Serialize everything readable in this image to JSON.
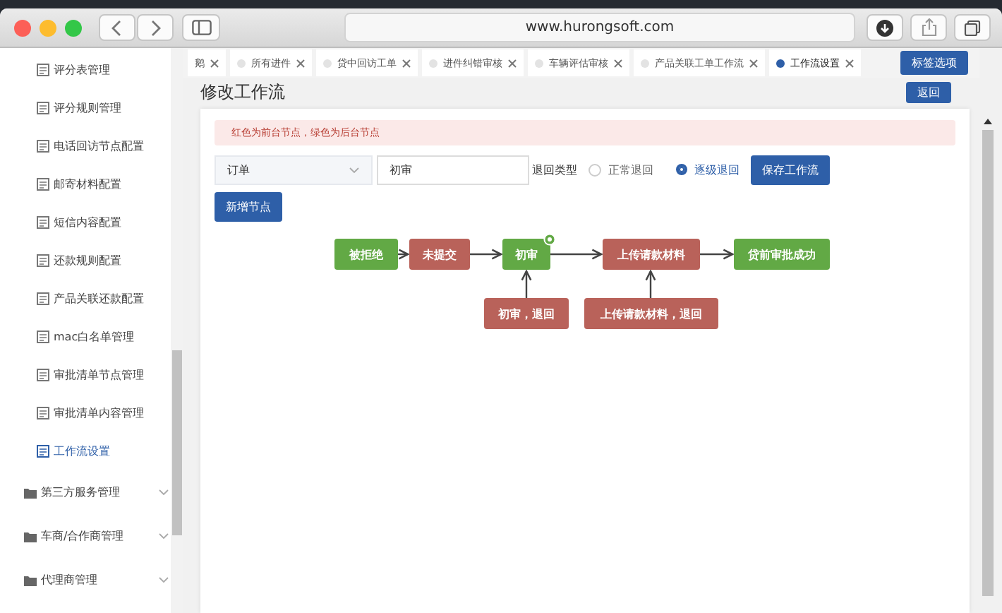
{
  "browser": {
    "url": "www.hurongsoft.com"
  },
  "sidebar": {
    "items": [
      {
        "label": "评分表管理",
        "selected": false
      },
      {
        "label": "评分规则管理",
        "selected": false
      },
      {
        "label": "电话回访节点配置",
        "selected": false
      },
      {
        "label": "邮寄材料配置",
        "selected": false
      },
      {
        "label": "短信内容配置",
        "selected": false
      },
      {
        "label": "还款规则配置",
        "selected": false
      },
      {
        "label": "产品关联还款配置",
        "selected": false
      },
      {
        "label": "mac白名单管理",
        "selected": false
      },
      {
        "label": "审批清单节点管理",
        "selected": false
      },
      {
        "label": "审批清单内容管理",
        "selected": false
      },
      {
        "label": "工作流设置",
        "selected": true
      }
    ],
    "groups": [
      {
        "label": "第三方服务管理",
        "expanded": false
      },
      {
        "label": "车商/合作商管理",
        "expanded": false
      },
      {
        "label": "代理商管理",
        "expanded": false
      }
    ]
  },
  "tabs": [
    {
      "label": "鹅",
      "selected": false,
      "cut": true
    },
    {
      "label": "所有进件",
      "selected": false,
      "cut": false
    },
    {
      "label": "贷中回访工单",
      "selected": false,
      "cut": false
    },
    {
      "label": "进件纠错审核",
      "selected": false,
      "cut": false
    },
    {
      "label": "车辆评估审核",
      "selected": false,
      "cut": false
    },
    {
      "label": "产品关联工单工作流",
      "selected": false,
      "cut": false
    },
    {
      "label": "工作流设置",
      "selected": true,
      "cut": false
    }
  ],
  "tab_options_button": "标签选项",
  "page": {
    "title": "修改工作流",
    "back_button": "返回"
  },
  "notice": "红色为前台节点，绿色为后台节点",
  "form": {
    "type_select": {
      "value": "订单"
    },
    "node_field": {
      "value": "初审"
    },
    "return_type_label": "退回类型",
    "return_options": [
      {
        "label": "正常退回",
        "selected": false
      },
      {
        "label": "逐级退回",
        "selected": true
      }
    ],
    "save_button": "保存工作流"
  },
  "add_node_button": "新增节点",
  "flow": {
    "nodes": [
      {
        "label": "被拒绝",
        "color": "#62a945",
        "current": false
      },
      {
        "label": "未提交",
        "color": "#b9625a",
        "current": false
      },
      {
        "label": "初审",
        "color": "#62a945",
        "current": true
      },
      {
        "label": "上传请款材料",
        "color": "#b9625a",
        "current": false
      },
      {
        "label": "贷前审批成功",
        "color": "#62a945",
        "current": false
      }
    ],
    "return_nodes": [
      {
        "label": "初审，退回",
        "color": "#b9625a"
      },
      {
        "label": "上传请款材料，退回",
        "color": "#b9625a"
      }
    ]
  }
}
